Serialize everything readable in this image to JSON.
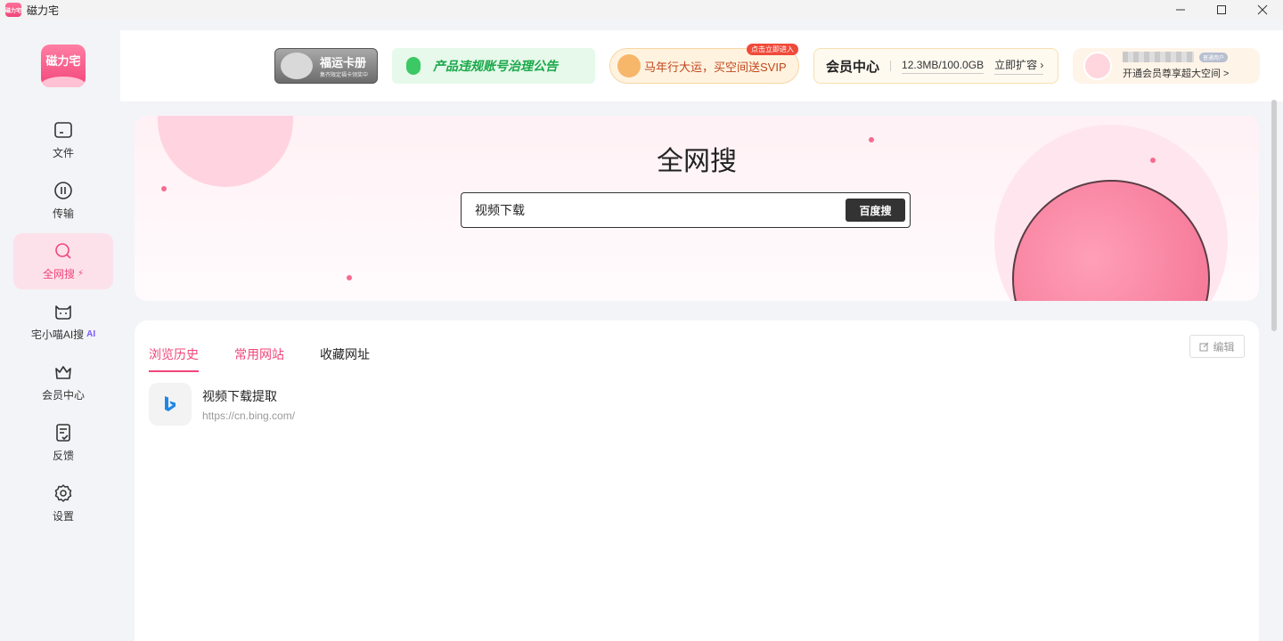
{
  "window": {
    "title": "磁力宅",
    "app_icon_text": "磁力宅",
    "controls": [
      "minimize-icon",
      "maximize-icon",
      "close-icon"
    ]
  },
  "sidebar": {
    "logo_text": "磁力宅",
    "items": [
      {
        "label": "文件",
        "icon": "folder-icon"
      },
      {
        "label": "传输",
        "icon": "transfer-icon"
      },
      {
        "label": "全网搜",
        "icon": "search-icon",
        "badge": "⚡",
        "active": true
      },
      {
        "label": "宅小喵AI搜",
        "icon": "cat-icon",
        "badge": "AI"
      },
      {
        "label": "会员中心",
        "icon": "crown-icon"
      },
      {
        "label": "反馈",
        "icon": "feedback-icon"
      },
      {
        "label": "设置",
        "icon": "gear-icon"
      }
    ]
  },
  "header": {
    "fuyun": {
      "title": "福运卡册",
      "subtitle": "集齐限定福卡领奖中"
    },
    "notice": "产品违规账号治理公告",
    "svip": {
      "text": "马年行大运，买空间送SVIP",
      "tag": "点击立即进入"
    },
    "member": {
      "title": "会员中心",
      "storage": "12.3MB/100.0GB",
      "expand": "立即扩容 ›"
    },
    "user": {
      "level": "普通用户",
      "cta": "开通会员尊享超大空间 >"
    }
  },
  "hero": {
    "title": "全网搜",
    "search_value": "视频下载",
    "search_button": "百度搜"
  },
  "content": {
    "tabs": [
      {
        "label": "浏览历史",
        "active": true
      },
      {
        "label": "常用网站",
        "active": false
      },
      {
        "label": "收藏网址",
        "active": false
      }
    ],
    "edit_label": "编辑",
    "history": [
      {
        "title": "视频下载提取",
        "url": "https://cn.bing.com/",
        "icon": "bing-icon"
      }
    ]
  },
  "colors": {
    "accent": "#f0467a",
    "accent_bg": "#fde1ea",
    "notice_green": "#19a84a"
  }
}
